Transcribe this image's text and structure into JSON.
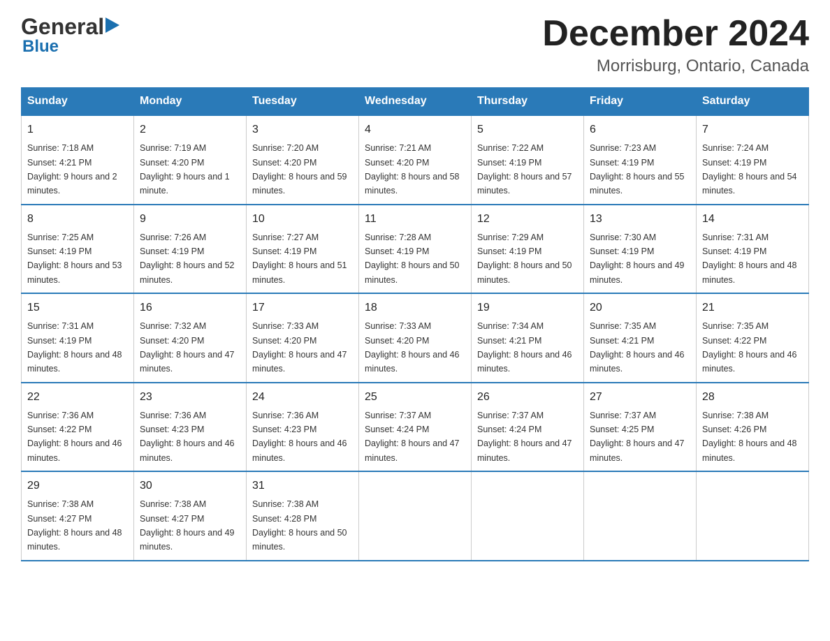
{
  "header": {
    "logo_general": "General",
    "logo_blue": "Blue",
    "month_title": "December 2024",
    "location": "Morrisburg, Ontario, Canada"
  },
  "days_of_week": [
    "Sunday",
    "Monday",
    "Tuesday",
    "Wednesday",
    "Thursday",
    "Friday",
    "Saturday"
  ],
  "weeks": [
    [
      {
        "day": "1",
        "sunrise": "7:18 AM",
        "sunset": "4:21 PM",
        "daylight": "9 hours and 2 minutes."
      },
      {
        "day": "2",
        "sunrise": "7:19 AM",
        "sunset": "4:20 PM",
        "daylight": "9 hours and 1 minute."
      },
      {
        "day": "3",
        "sunrise": "7:20 AM",
        "sunset": "4:20 PM",
        "daylight": "8 hours and 59 minutes."
      },
      {
        "day": "4",
        "sunrise": "7:21 AM",
        "sunset": "4:20 PM",
        "daylight": "8 hours and 58 minutes."
      },
      {
        "day": "5",
        "sunrise": "7:22 AM",
        "sunset": "4:19 PM",
        "daylight": "8 hours and 57 minutes."
      },
      {
        "day": "6",
        "sunrise": "7:23 AM",
        "sunset": "4:19 PM",
        "daylight": "8 hours and 55 minutes."
      },
      {
        "day": "7",
        "sunrise": "7:24 AM",
        "sunset": "4:19 PM",
        "daylight": "8 hours and 54 minutes."
      }
    ],
    [
      {
        "day": "8",
        "sunrise": "7:25 AM",
        "sunset": "4:19 PM",
        "daylight": "8 hours and 53 minutes."
      },
      {
        "day": "9",
        "sunrise": "7:26 AM",
        "sunset": "4:19 PM",
        "daylight": "8 hours and 52 minutes."
      },
      {
        "day": "10",
        "sunrise": "7:27 AM",
        "sunset": "4:19 PM",
        "daylight": "8 hours and 51 minutes."
      },
      {
        "day": "11",
        "sunrise": "7:28 AM",
        "sunset": "4:19 PM",
        "daylight": "8 hours and 50 minutes."
      },
      {
        "day": "12",
        "sunrise": "7:29 AM",
        "sunset": "4:19 PM",
        "daylight": "8 hours and 50 minutes."
      },
      {
        "day": "13",
        "sunrise": "7:30 AM",
        "sunset": "4:19 PM",
        "daylight": "8 hours and 49 minutes."
      },
      {
        "day": "14",
        "sunrise": "7:31 AM",
        "sunset": "4:19 PM",
        "daylight": "8 hours and 48 minutes."
      }
    ],
    [
      {
        "day": "15",
        "sunrise": "7:31 AM",
        "sunset": "4:19 PM",
        "daylight": "8 hours and 48 minutes."
      },
      {
        "day": "16",
        "sunrise": "7:32 AM",
        "sunset": "4:20 PM",
        "daylight": "8 hours and 47 minutes."
      },
      {
        "day": "17",
        "sunrise": "7:33 AM",
        "sunset": "4:20 PM",
        "daylight": "8 hours and 47 minutes."
      },
      {
        "day": "18",
        "sunrise": "7:33 AM",
        "sunset": "4:20 PM",
        "daylight": "8 hours and 46 minutes."
      },
      {
        "day": "19",
        "sunrise": "7:34 AM",
        "sunset": "4:21 PM",
        "daylight": "8 hours and 46 minutes."
      },
      {
        "day": "20",
        "sunrise": "7:35 AM",
        "sunset": "4:21 PM",
        "daylight": "8 hours and 46 minutes."
      },
      {
        "day": "21",
        "sunrise": "7:35 AM",
        "sunset": "4:22 PM",
        "daylight": "8 hours and 46 minutes."
      }
    ],
    [
      {
        "day": "22",
        "sunrise": "7:36 AM",
        "sunset": "4:22 PM",
        "daylight": "8 hours and 46 minutes."
      },
      {
        "day": "23",
        "sunrise": "7:36 AM",
        "sunset": "4:23 PM",
        "daylight": "8 hours and 46 minutes."
      },
      {
        "day": "24",
        "sunrise": "7:36 AM",
        "sunset": "4:23 PM",
        "daylight": "8 hours and 46 minutes."
      },
      {
        "day": "25",
        "sunrise": "7:37 AM",
        "sunset": "4:24 PM",
        "daylight": "8 hours and 47 minutes."
      },
      {
        "day": "26",
        "sunrise": "7:37 AM",
        "sunset": "4:24 PM",
        "daylight": "8 hours and 47 minutes."
      },
      {
        "day": "27",
        "sunrise": "7:37 AM",
        "sunset": "4:25 PM",
        "daylight": "8 hours and 47 minutes."
      },
      {
        "day": "28",
        "sunrise": "7:38 AM",
        "sunset": "4:26 PM",
        "daylight": "8 hours and 48 minutes."
      }
    ],
    [
      {
        "day": "29",
        "sunrise": "7:38 AM",
        "sunset": "4:27 PM",
        "daylight": "8 hours and 48 minutes."
      },
      {
        "day": "30",
        "sunrise": "7:38 AM",
        "sunset": "4:27 PM",
        "daylight": "8 hours and 49 minutes."
      },
      {
        "day": "31",
        "sunrise": "7:38 AM",
        "sunset": "4:28 PM",
        "daylight": "8 hours and 50 minutes."
      },
      null,
      null,
      null,
      null
    ]
  ],
  "labels": {
    "sunrise": "Sunrise:",
    "sunset": "Sunset:",
    "daylight": "Daylight:"
  }
}
